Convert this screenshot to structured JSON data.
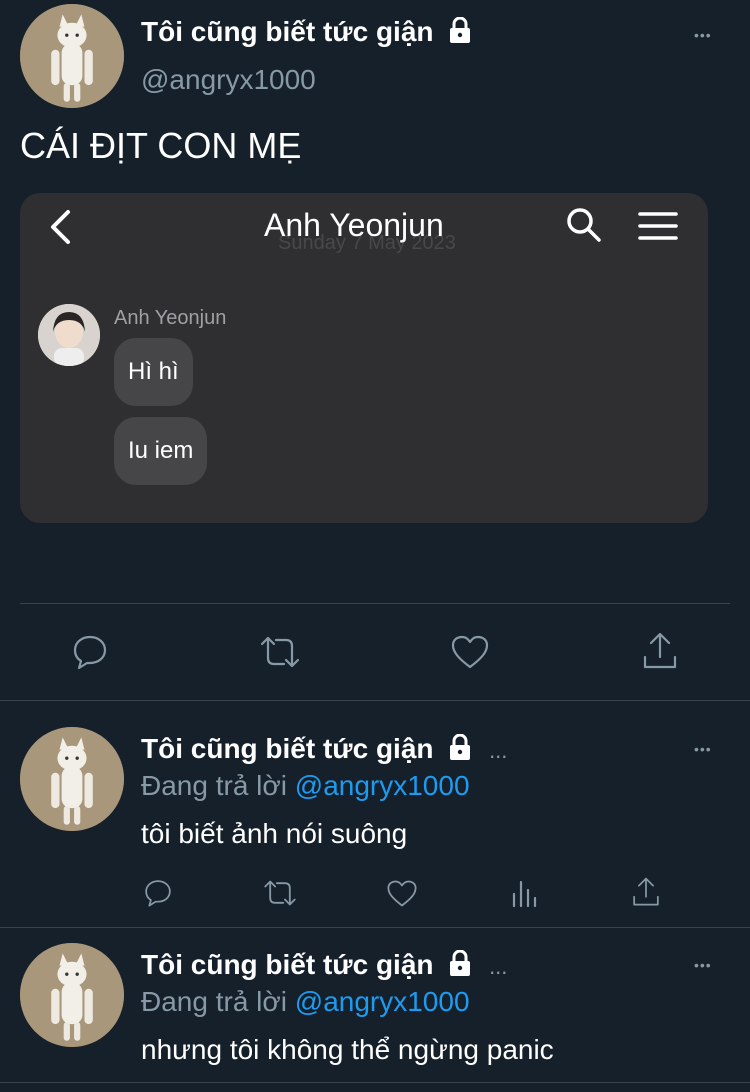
{
  "main_tweet": {
    "display_name": "Tôi cũng biết tức giận",
    "handle": "@angryx1000",
    "more": "•••",
    "text": "CÁI ĐỊT CON MẸ",
    "chat": {
      "title": "Anh Yeonjun",
      "date": "Sunday 7 May 2023",
      "sender": "Anh Yeonjun",
      "messages": [
        "Hì hì",
        "Iu iem"
      ]
    }
  },
  "replies": [
    {
      "display_name": "Tôi cũng biết tức giận",
      "ellipsis": "...",
      "replying_prefix": "Đang trả lời",
      "replying_to": "@angryx1000",
      "more": "•••",
      "text": "tôi biết ảnh nói suông"
    },
    {
      "display_name": "Tôi cũng biết tức giận",
      "ellipsis": "...",
      "replying_prefix": "Đang trả lời",
      "replying_to": "@angryx1000",
      "more": "•••",
      "text": "nhưng tôi không thể ngừng panic"
    }
  ],
  "colors": {
    "background": "#15202b",
    "text": "#ffffff",
    "muted": "#8899a6",
    "accent": "#1d9bf0",
    "divider": "#38444d",
    "chat_bg": "#2f2f31",
    "bubble": "#464648"
  },
  "icons": {
    "lock": "lock-icon",
    "reply": "comment-icon",
    "retweet": "retweet-icon",
    "like": "heart-icon",
    "views": "bar-chart-icon",
    "share": "share-icon",
    "back": "chevron-left-icon",
    "search": "search-icon",
    "menu": "hamburger-menu-icon"
  }
}
